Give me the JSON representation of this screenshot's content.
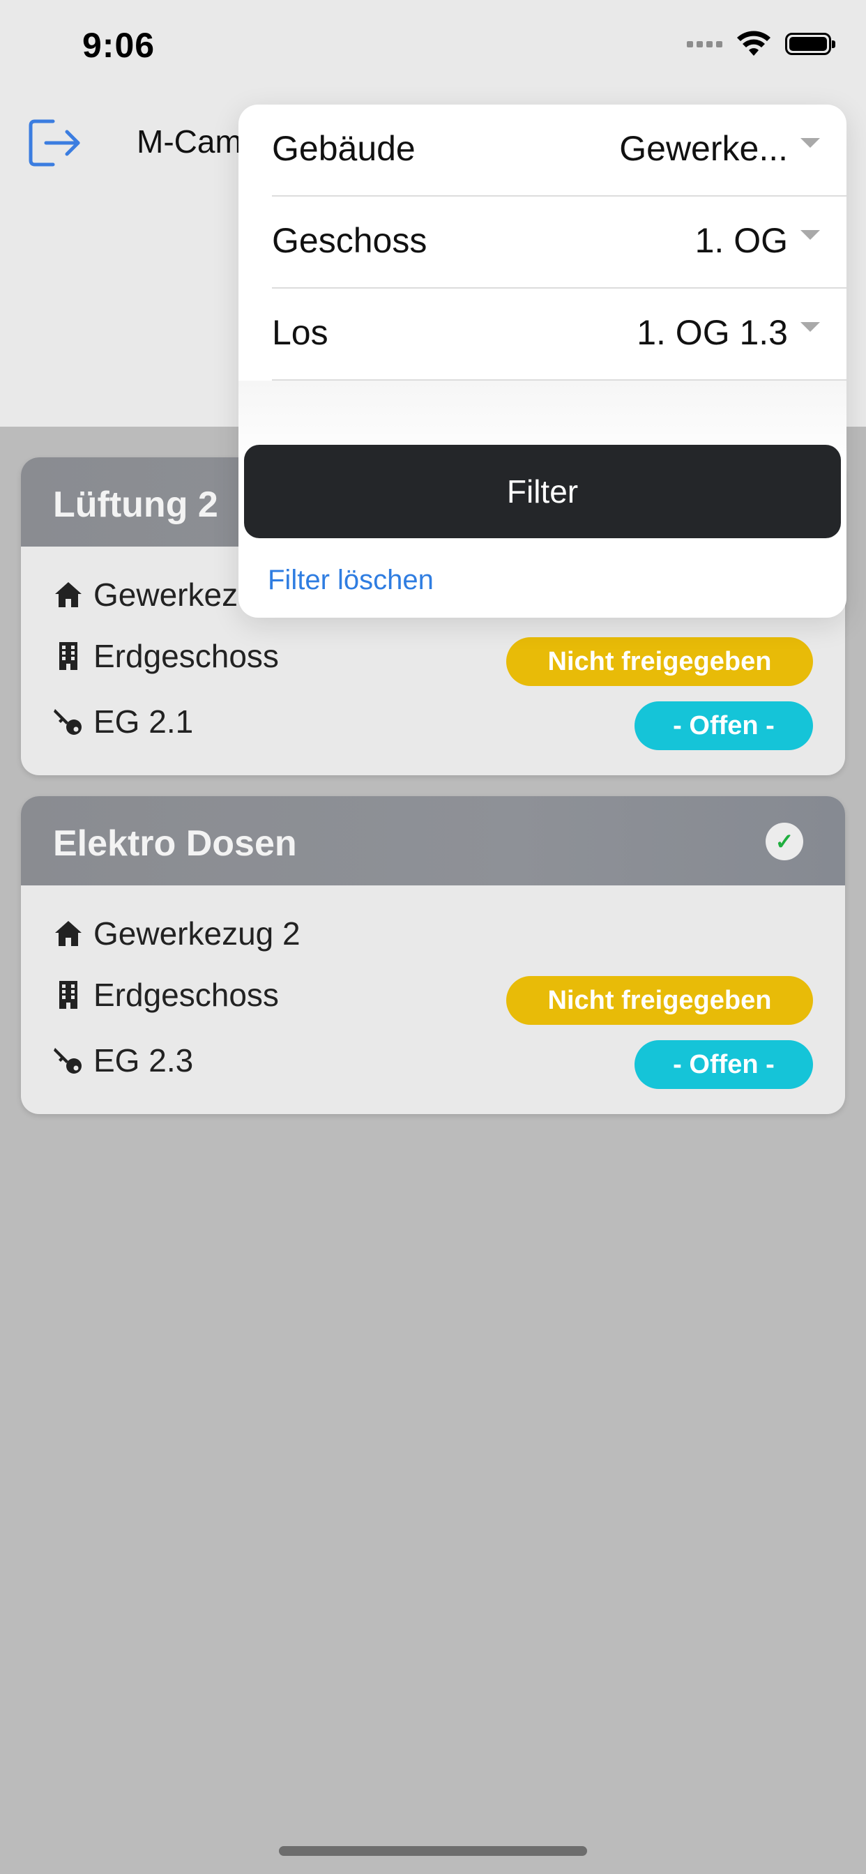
{
  "status_bar": {
    "time": "9:06"
  },
  "header": {
    "title": "M-Campus"
  },
  "filter_popover": {
    "rows": [
      {
        "label": "Gebäude",
        "value": "Gewerke..."
      },
      {
        "label": "Geschoss",
        "value": "1. OG"
      },
      {
        "label": "Los",
        "value": "1. OG 1.3"
      }
    ],
    "filter_button": "Filter",
    "clear_link": "Filter löschen"
  },
  "cards": [
    {
      "title": "Lüftung 2",
      "building": "Gewerkezug 2",
      "floor": "Erdgeschoss",
      "lot": "EG 2.1",
      "release_status": "Nicht freigegeben",
      "state": "- Offen -",
      "checked": false
    },
    {
      "title": "Elektro Dosen",
      "building": "Gewerkezug 2",
      "floor": "Erdgeschoss",
      "lot": "EG 2.3",
      "release_status": "Nicht freigegeben",
      "state": "- Offen -",
      "checked": true,
      "check_glyph": "✓"
    }
  ],
  "colors": {
    "accent_blue": "#2f7de1",
    "badge_yellow": "#e8bb08",
    "badge_cyan": "#15c4d8",
    "card_header": "#8a8d93",
    "filter_button": "#242629"
  },
  "icons": {
    "logout": "logout-icon",
    "building": "home-icon",
    "floor": "building-icon",
    "lot": "key-icon",
    "check": "check-icon"
  }
}
